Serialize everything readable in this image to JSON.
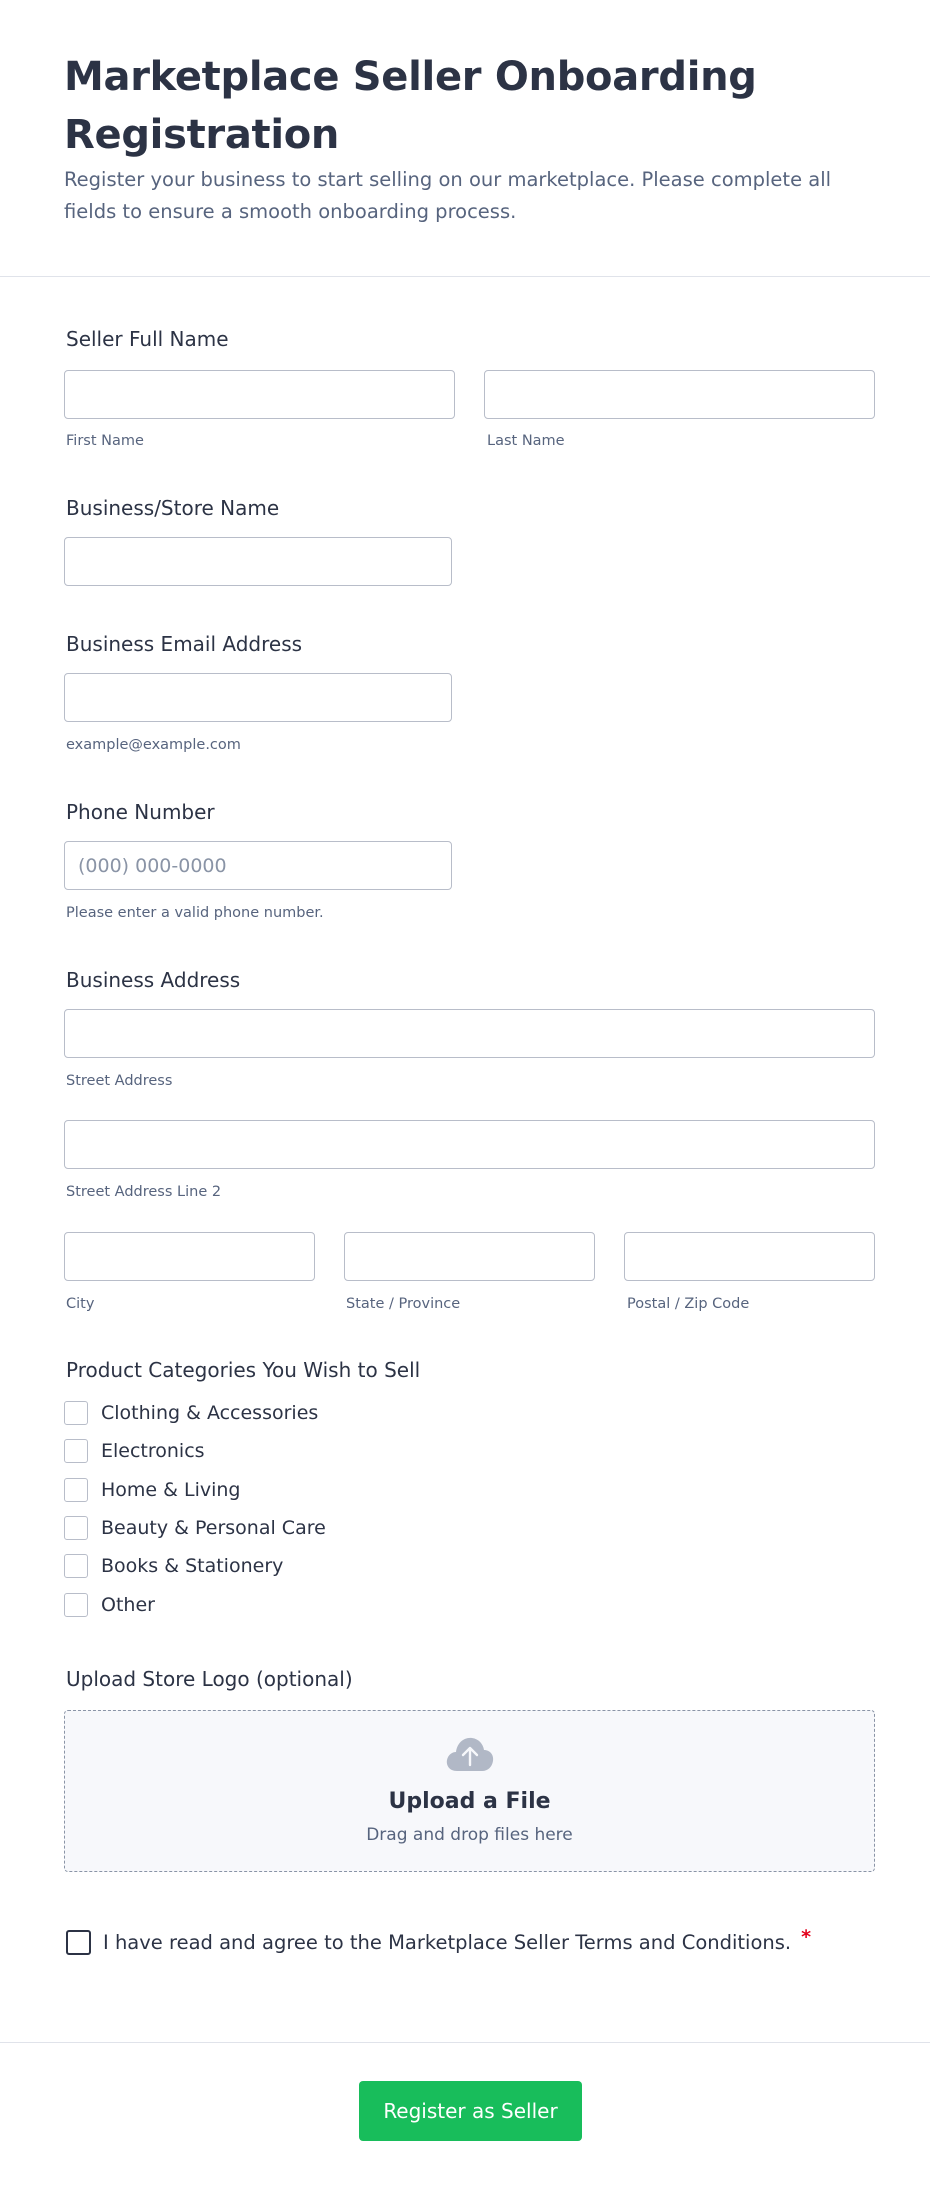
{
  "header": {
    "title": "Marketplace Seller Onboarding Registration",
    "subtitle": "Register your business to start selling on our marketplace. Please complete all fields to ensure a smooth onboarding process."
  },
  "fields": {
    "full_name": {
      "label": "Seller Full Name",
      "first_value": "",
      "first_sublabel": "First Name",
      "last_value": "",
      "last_sublabel": "Last Name"
    },
    "business_name": {
      "label": "Business/Store Name",
      "value": ""
    },
    "email": {
      "label": "Business Email Address",
      "value": "",
      "sublabel": "example@example.com"
    },
    "phone": {
      "label": "Phone Number",
      "value": "",
      "placeholder": "(000) 000-0000",
      "sublabel": "Please enter a valid phone number."
    },
    "address": {
      "label": "Business Address",
      "street_sublabel": "Street Address",
      "street2_sublabel": "Street Address Line 2",
      "city_sublabel": "City",
      "state_sublabel": "State / Province",
      "postal_sublabel": "Postal / Zip Code"
    }
  },
  "categories": {
    "label": "Product Categories You Wish to Sell",
    "options": [
      {
        "label": "Clothing & Accessories",
        "checked": false
      },
      {
        "label": "Electronics",
        "checked": false
      },
      {
        "label": "Home & Living",
        "checked": false
      },
      {
        "label": "Beauty & Personal Care",
        "checked": false
      },
      {
        "label": "Books & Stationery",
        "checked": false
      },
      {
        "label": "Other",
        "checked": false
      }
    ]
  },
  "upload": {
    "label": "Upload Store Logo (optional)",
    "title": "Upload a File",
    "subtitle": "Drag and drop files here",
    "icon": "cloud-upload-icon"
  },
  "terms": {
    "label": "I have read and agree to the Marketplace Seller Terms and Conditions.",
    "required_mark": "*",
    "checked": false
  },
  "submit": {
    "label": "Register as Seller"
  },
  "colors": {
    "text": "#2c3345",
    "muted": "#57647e",
    "border": "#b8bdc9",
    "submit_bg": "#18bd5b",
    "required": "#e3021c"
  }
}
